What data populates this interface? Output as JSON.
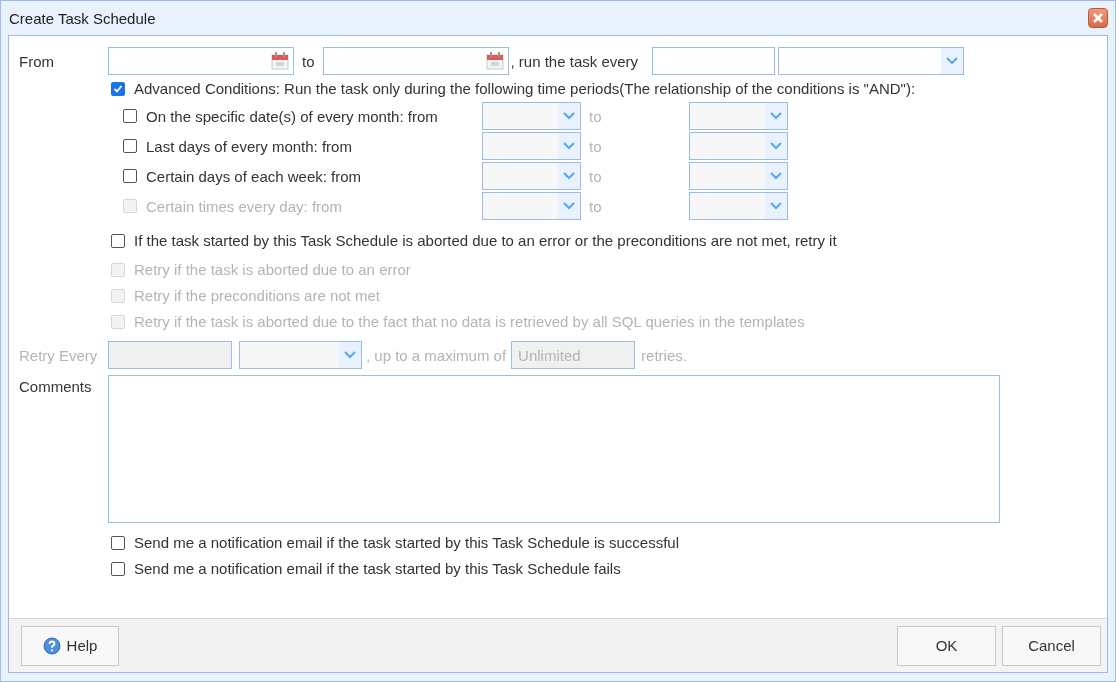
{
  "window": {
    "title": "Create Task Schedule"
  },
  "schedule": {
    "from_label": "From",
    "to_label": "to",
    "every_label": ", run the task every"
  },
  "advanced": {
    "label": "Advanced Conditions: Run the task only during the following time periods(The relationship of the conditions is \"AND\"):",
    "checked": true
  },
  "conditions": [
    {
      "label": "On the specific date(s) of every month: from",
      "checked": false,
      "disabled": false,
      "to_label": "to"
    },
    {
      "label": "Last days of every month: from",
      "checked": false,
      "disabled": false,
      "to_label": "to"
    },
    {
      "label": "Certain days of each week: from",
      "checked": false,
      "disabled": false,
      "to_label": "to"
    },
    {
      "label": "Certain times every day: from",
      "checked": false,
      "disabled": true,
      "to_label": "to"
    }
  ],
  "retry": {
    "label": "If the task started by this Task Schedule is aborted due to an error or the preconditions are not met, retry it",
    "checked": false
  },
  "retry_options": [
    {
      "label": "Retry if the task is aborted due to an error",
      "checked": false,
      "disabled": true
    },
    {
      "label": "Retry if the preconditions are not met",
      "checked": false,
      "disabled": true
    },
    {
      "label": "Retry if the task is aborted due to the fact that no data is retrieved by all SQL queries in the templates",
      "checked": false,
      "disabled": true
    }
  ],
  "retry_every": {
    "label": "Retry Every",
    "max_label": ", up to a maximum of",
    "max_value": "Unlimited",
    "suffix": "retries.",
    "disabled": true
  },
  "comments": {
    "label": "Comments"
  },
  "notifications": [
    {
      "label": "Send me a notification email if the task started by this Task Schedule is successful",
      "checked": false
    },
    {
      "label": "Send me a notification email if the task started by this Task Schedule fails",
      "checked": false
    }
  ],
  "buttons": [
    {
      "label": "Help",
      "kind": "help"
    },
    {
      "label": "OK",
      "kind": "ok"
    },
    {
      "label": "Cancel",
      "kind": "cancel"
    }
  ]
}
